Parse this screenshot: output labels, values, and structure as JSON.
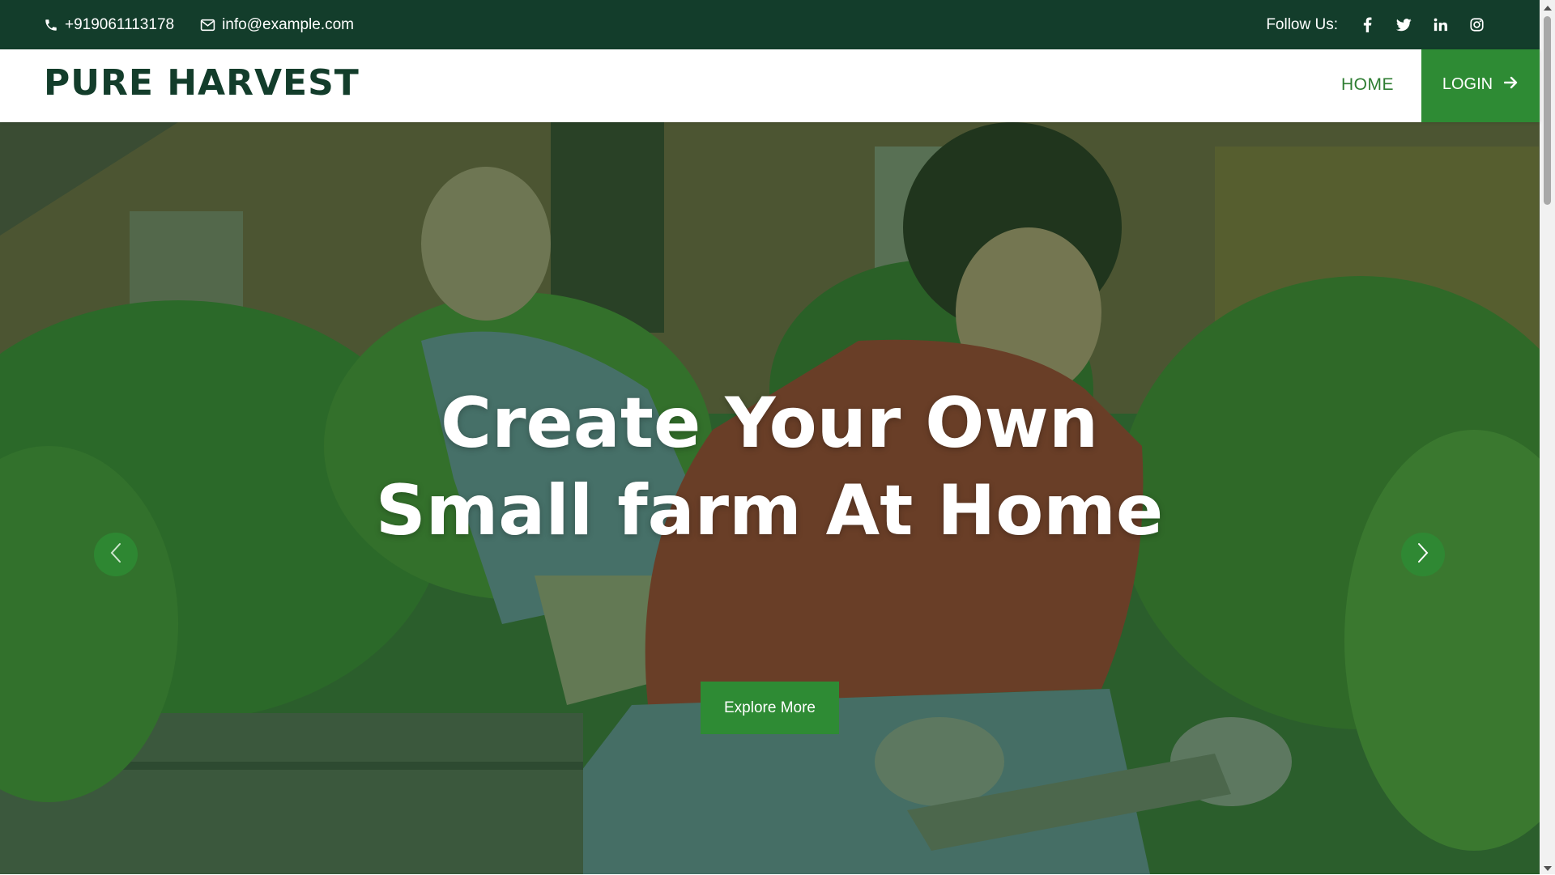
{
  "topbar": {
    "phone": "+919061113178",
    "email": "info@example.com",
    "follow_label": "Follow Us:",
    "socials": [
      "facebook-icon",
      "twitter-icon",
      "linkedin-icon",
      "instagram-icon"
    ]
  },
  "navbar": {
    "brand": "PURE HARVEST",
    "home": "HOME",
    "login": "LOGIN"
  },
  "hero": {
    "title": "Create Your Own Small farm At Home",
    "button": "Explore More"
  },
  "colors": {
    "topbar_bg": "#133d2b",
    "accent": "#2e8b34",
    "brand_text": "#133d2b",
    "hero_overlay": "rgba(20,80,35,0.45)"
  }
}
